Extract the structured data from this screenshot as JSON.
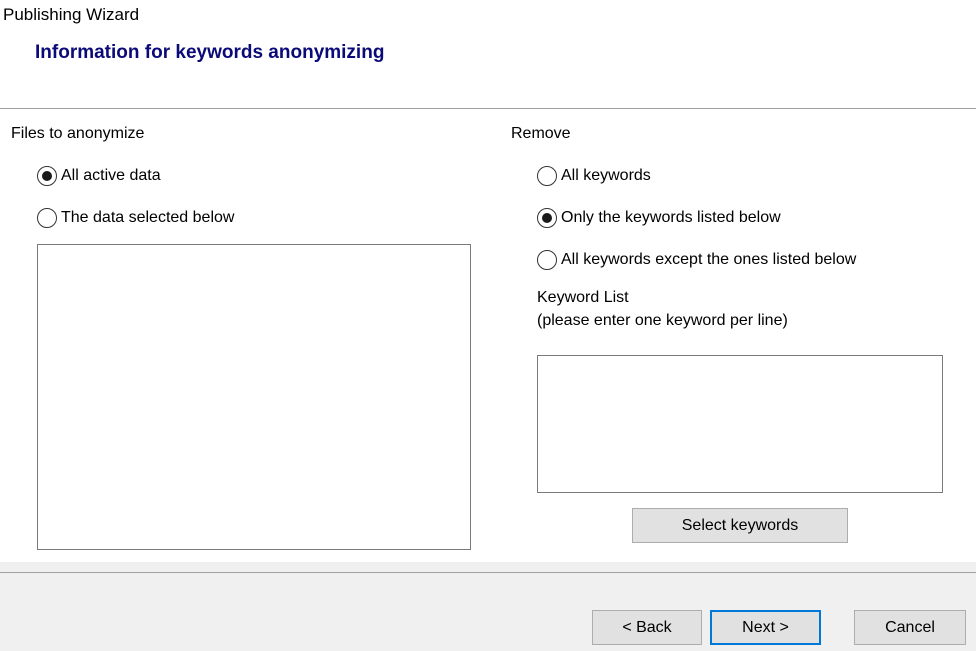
{
  "window": {
    "title": "Publishing Wizard"
  },
  "header": {
    "heading": "Information for keywords anonymizing"
  },
  "files": {
    "label": "Files to anonymize",
    "options": [
      {
        "label": "All active data",
        "selected": true
      },
      {
        "label": "The data selected below",
        "selected": false
      }
    ]
  },
  "remove": {
    "label": "Remove",
    "options": [
      {
        "label": "All keywords",
        "selected": false
      },
      {
        "label": "Only the keywords listed below",
        "selected": true
      },
      {
        "label": "All keywords except the ones listed below",
        "selected": false
      }
    ],
    "keyword_list_label": "Keyword List",
    "keyword_list_hint": "(please enter one keyword per line)",
    "keyword_list_value": "",
    "select_keywords_button": "Select keywords"
  },
  "footer": {
    "back_button": "< Back",
    "next_button": "Next >",
    "cancel_button": "Cancel"
  }
}
